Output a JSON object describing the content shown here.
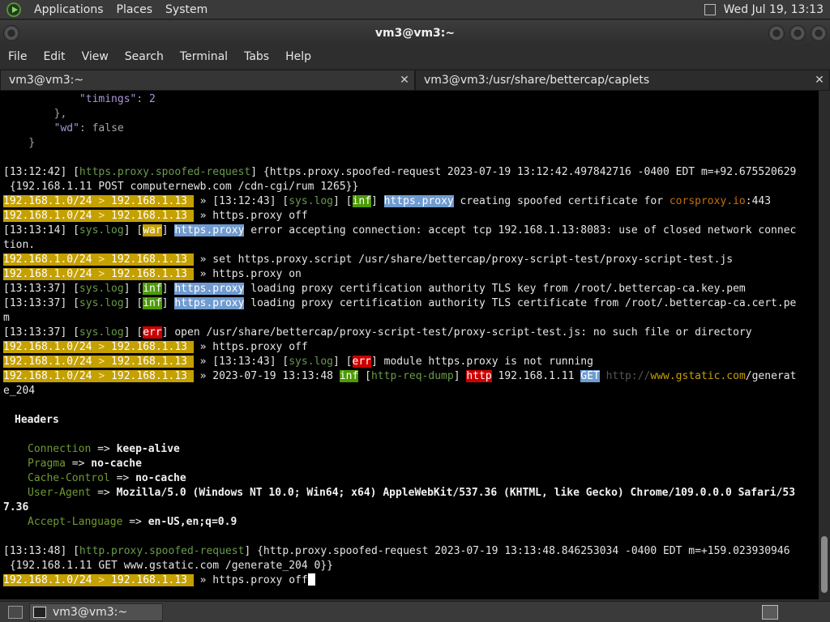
{
  "panel": {
    "menus": [
      "Applications",
      "Places",
      "System"
    ],
    "clock": "Wed Jul 19, 13:13"
  },
  "window": {
    "title": "vm3@vm3:~"
  },
  "menubar": [
    "File",
    "Edit",
    "View",
    "Search",
    "Terminal",
    "Tabs",
    "Help"
  ],
  "tabs": [
    {
      "label": "vm3@vm3:~"
    },
    {
      "label": "vm3@vm3:/usr/share/bettercap/caplets"
    }
  ],
  "terminal": {
    "json_lines": [
      "            \"timings\": 2",
      "        },",
      "        \"wd\": false",
      "    }"
    ],
    "prompt": "192.168.1.0/24 > 192.168.1.13 ",
    "l1": "[13:12:42] [https.proxy.spoofed-request] {https.proxy.spoofed-request 2023-07-19 13:12:42.497842716 -0400 EDT m=+92.675520629",
    "l2": " {192.168.1.11 POST computernewb.com /cdn-cgi/rum 1265}}",
    "l3_post": " » [13:12:43] [sys.log] [inf] https.proxy creating spoofed certificate for corsproxy.io:443",
    "cmd_off": " » https.proxy off",
    "l5": "[13:13:14] [sys.log] [war] https.proxy error accepting connection: accept tcp 192.168.1.13:8083: use of closed network connec",
    "l6": "tion.",
    "cmd_script": " » set https.proxy.script /usr/share/bettercap/proxy-script-test/proxy-script-test.js",
    "cmd_on": " » https.proxy on",
    "l9": "[13:13:37] [sys.log] [inf] https.proxy loading proxy certification authority TLS key from /root/.bettercap-ca.key.pem",
    "l10": "[13:13:37] [sys.log] [inf] https.proxy loading proxy certification authority TLS certificate from /root/.bettercap-ca.cert.pe",
    "l11": "m",
    "l12": "[13:13:37] [sys.log] [err] open /usr/share/bettercap/proxy-script-test/proxy-script-test.js: no such file or directory",
    "l14": " » [13:13:43] [sys.log] [err] module https.proxy is not running",
    "l15": " » 2023-07-19 13:13:48 inf [http-req-dump] http 192.168.1.11 GET http://www.gstatic.com/generat",
    "l16": "e_204",
    "headers_title": "Headers",
    "headers": [
      {
        "key": "Connection",
        "value": "keep-alive"
      },
      {
        "key": "Pragma",
        "value": "no-cache"
      },
      {
        "key": "Cache-Control",
        "value": "no-cache"
      },
      {
        "key": "User-Agent",
        "value": "Mozilla/5.0 (Windows NT 10.0; Win64; x64) AppleWebKit/537.36 (KHTML, like Gecko) Chrome/109.0.0.0 Safari/53"
      },
      {
        "key": "Accept-Language",
        "value": "en-US,en;q=0.9"
      }
    ],
    "ua_wrap": "7.36",
    "l_last1": "[13:13:48] [http.proxy.spoofed-request] {http.proxy.spoofed-request 2023-07-19 13:13:48.846253034 -0400 EDT m=+159.023930946",
    "l_last2": " {192.168.1.11 GET www.gstatic.com /generate_204 0}}"
  },
  "taskbar": {
    "task_label": "vm3@vm3:~"
  },
  "colors": {
    "prompt_bg": "#c4a000",
    "inf_bg": "#4e9a06",
    "err_bg": "#cc0000",
    "proxy_tag_bg": "#6f9bd0"
  }
}
